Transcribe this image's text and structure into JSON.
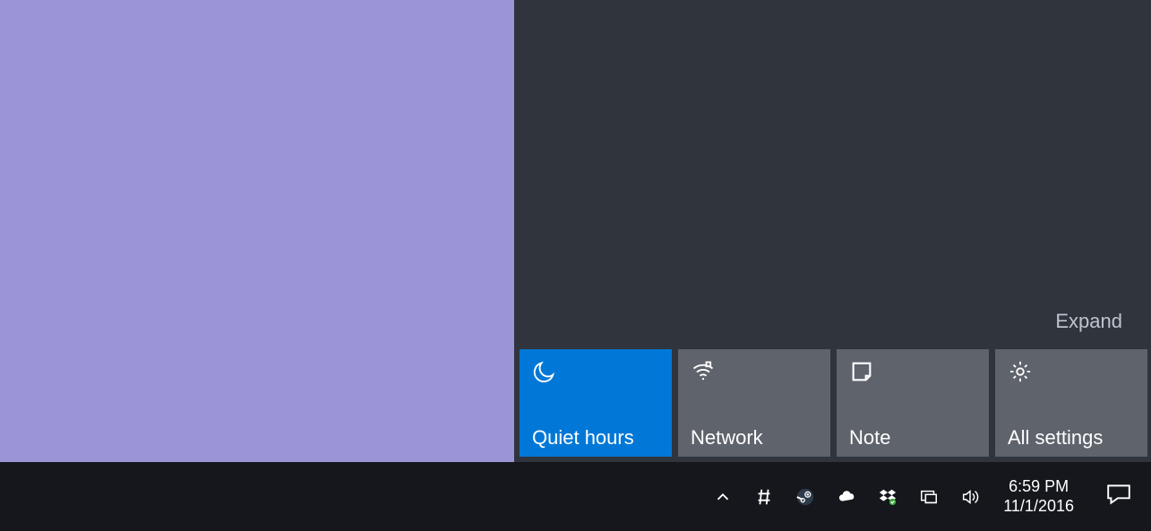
{
  "action_center": {
    "expand_label": "Expand",
    "tiles": [
      {
        "label": "Quiet hours",
        "active": true,
        "icon": "moon-icon"
      },
      {
        "label": "Network",
        "active": false,
        "icon": "wifi-icon"
      },
      {
        "label": "Note",
        "active": false,
        "icon": "note-icon"
      },
      {
        "label": "All settings",
        "active": false,
        "icon": "gear-icon"
      }
    ]
  },
  "taskbar": {
    "tray_icons": [
      "chevron-up-icon",
      "hash-icon",
      "steam-icon",
      "onedrive-icon",
      "dropbox-icon",
      "monitor-icon",
      "speaker-icon"
    ],
    "time": "6:59 PM",
    "date": "11/1/2016",
    "action_center_icon": "notification-icon"
  }
}
